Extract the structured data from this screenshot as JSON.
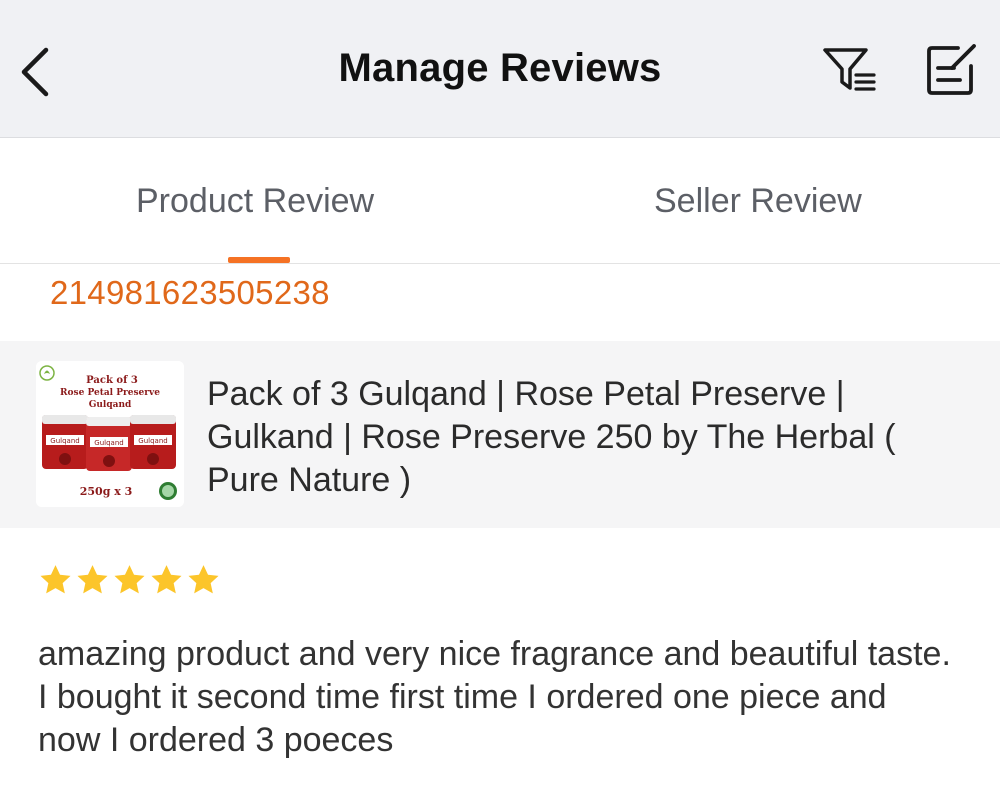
{
  "header": {
    "title": "Manage Reviews",
    "back_icon": "chevron-left-icon",
    "filter_icon": "filter-icon",
    "edit_icon": "edit-icon"
  },
  "tabs": [
    {
      "label": "Product Review",
      "active": true
    },
    {
      "label": "Seller Review",
      "active": false
    }
  ],
  "accent_color": "#f57224",
  "order_number": "214981623505238",
  "product": {
    "name": "Pack of 3 Gulqand | Rose Petal Preserve | Gulkand | Rose Preserve 250 by The Herbal ( Pure Nature )",
    "thumbnail": {
      "pack_line1": "Pack of 3",
      "pack_line2": "Rose Petal Preserve",
      "pack_line3": "Gulqand",
      "jar_label": "Gulqand",
      "weight": "250g x 3"
    }
  },
  "review": {
    "rating": 5,
    "max_rating": 5,
    "star_color": "#fcc52a",
    "text": "amazing product and very nice fragrance and beautiful taste. I bought it second time first time I ordered one piece and now I ordered 3 poeces"
  }
}
